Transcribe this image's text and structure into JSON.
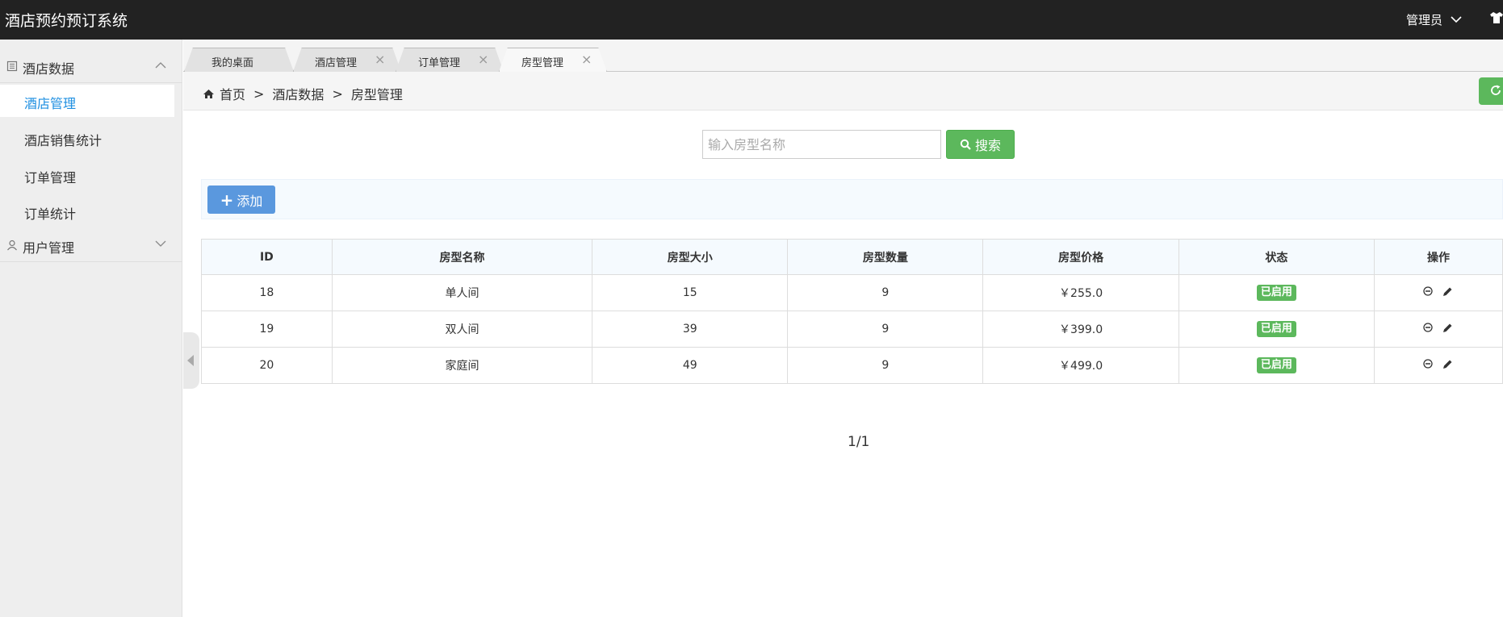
{
  "app": {
    "title": "酒店预约预订系统",
    "user": "管理员"
  },
  "sidebar": {
    "groups": [
      {
        "label": "酒店数据",
        "items": [
          {
            "label": "酒店管理",
            "active": true
          },
          {
            "label": "酒店销售统计"
          },
          {
            "label": "订单管理"
          },
          {
            "label": "订单统计"
          }
        ]
      },
      {
        "label": "用户管理",
        "items": []
      }
    ]
  },
  "tabs": [
    {
      "label": "我的桌面",
      "closable": false
    },
    {
      "label": "酒店管理",
      "closable": true
    },
    {
      "label": "订单管理",
      "closable": true
    },
    {
      "label": "房型管理",
      "closable": true,
      "active": true
    }
  ],
  "breadcrumb": {
    "home": "首页",
    "sep": ">",
    "level1": "酒店数据",
    "level2": "房型管理"
  },
  "search": {
    "placeholder": "输入房型名称",
    "button": "搜索"
  },
  "toolbar": {
    "add_label": "添加"
  },
  "table": {
    "headers": [
      "ID",
      "房型名称",
      "房型大小",
      "房型数量",
      "房型价格",
      "状态",
      "操作"
    ],
    "rows": [
      [
        "18",
        "单人间",
        "15",
        "9",
        "￥255.0",
        "已启用"
      ],
      [
        "19",
        "双人间",
        "39",
        "9",
        "￥399.0",
        "已启用"
      ],
      [
        "20",
        "家庭间",
        "49",
        "9",
        "￥499.0",
        "已启用"
      ]
    ]
  },
  "pagination": {
    "text": "1/1"
  },
  "colors": {
    "topbar": "#222222",
    "accent_green": "#5cb85c",
    "accent_blue": "#5a98de",
    "active_link": "#1e8fe1"
  }
}
